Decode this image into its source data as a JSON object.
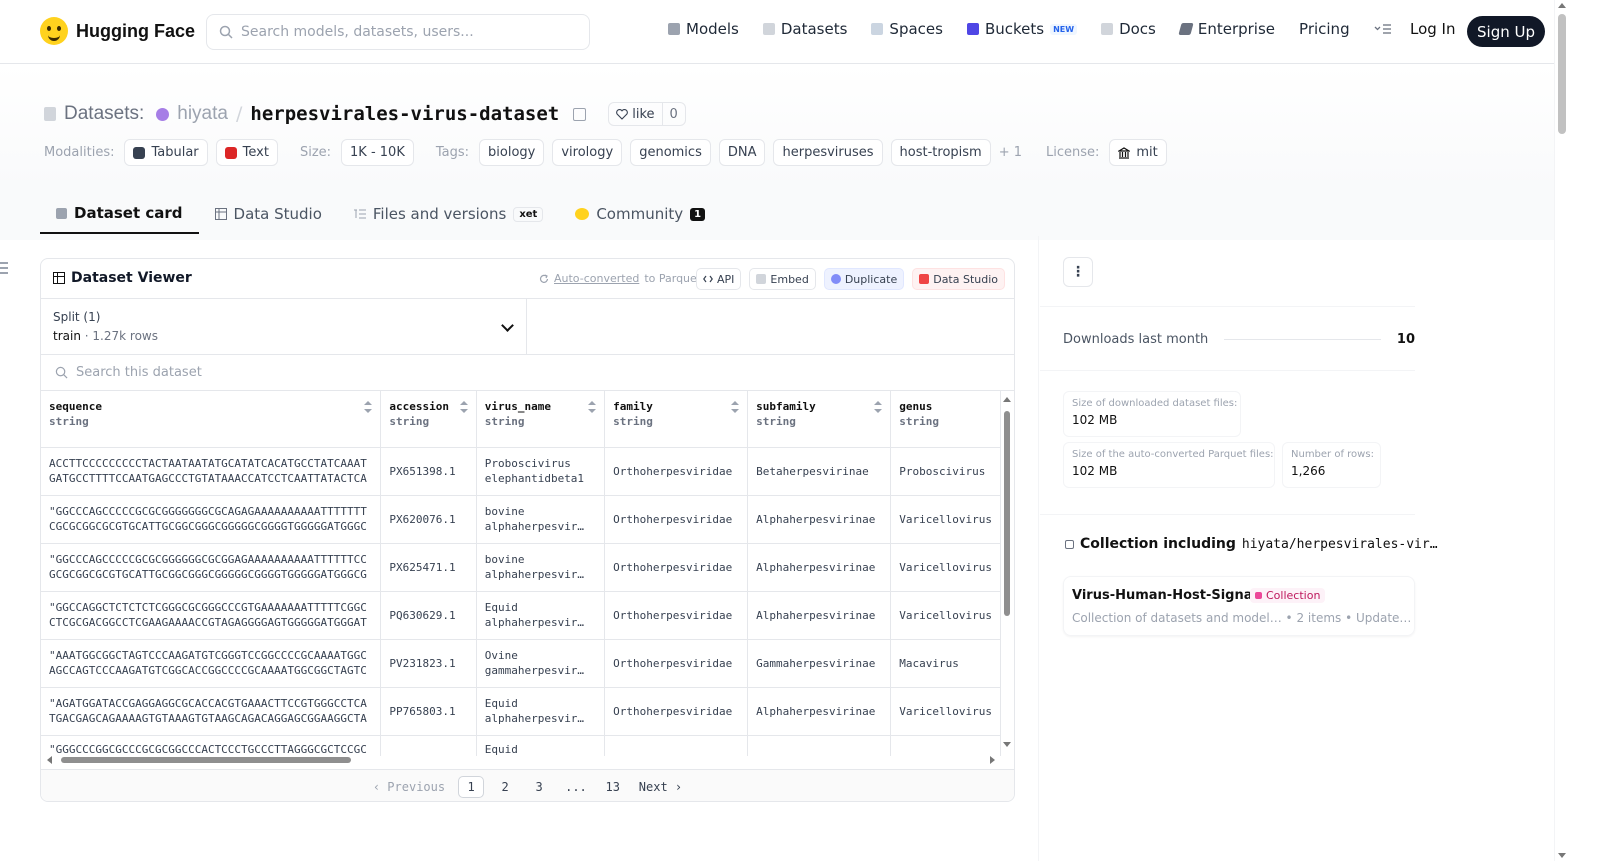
{
  "nav": {
    "brand": "Hugging Face",
    "search_placeholder": "Search models, datasets, users...",
    "links": [
      "Models",
      "Datasets",
      "Spaces",
      "Buckets",
      "Docs",
      "Enterprise",
      "Pricing"
    ],
    "buckets_badge": "NEW",
    "login": "Log In",
    "signup": "Sign Up"
  },
  "header": {
    "datasets_label": "Datasets:",
    "owner": "hiyata",
    "slash": "/",
    "repo": "herpesvirales-virus-dataset",
    "like_label": "like",
    "like_count": "0",
    "modalities_label": "Modalities:",
    "modalities": [
      "Tabular",
      "Text"
    ],
    "size_label": "Size:",
    "size": "1K - 10K",
    "tags_label": "Tags:",
    "tags": [
      "biology",
      "virology",
      "genomics",
      "DNA",
      "herpesviruses",
      "host-tropism"
    ],
    "tags_more": "+ 1",
    "license_label": "License:",
    "license": "mit"
  },
  "tabs": {
    "card": "Dataset card",
    "studio": "Data Studio",
    "files": "Files and versions",
    "xet": "xet",
    "community": "Community",
    "community_count": "1"
  },
  "viewer": {
    "title": "Dataset Viewer",
    "autoconv_link": "Auto-converted",
    "autoconv_rest": "to Parquet",
    "buttons": [
      "API",
      "Embed",
      "Duplicate",
      "Data Studio"
    ],
    "split_label": "Split (1)",
    "split_name": "train",
    "split_sep": "·",
    "split_rows": "1.27k rows",
    "search_placeholder": "Search this dataset",
    "columns": [
      {
        "name": "sequence",
        "type": "string"
      },
      {
        "name": "accession",
        "type": "string"
      },
      {
        "name": "virus_name",
        "type": "string"
      },
      {
        "name": "family",
        "type": "string"
      },
      {
        "name": "subfamily",
        "type": "string"
      },
      {
        "name": "genus",
        "type": "string"
      }
    ],
    "rows": [
      {
        "sequence": "ACCTTCCCCCCCCCTACTAATAATATGCATATCACATGCCTATCAAATGATGCCTTTTCCAATGAGCCCTGTATAAACCATCCTCAATTATACTCATTGGC…",
        "accession": "PX651398.1",
        "virus_name_1": "Proboscivirus",
        "virus_name_2": "elephantidbeta1",
        "family": "Orthoherpesviridae",
        "subfamily": "Betaherpesvirinae",
        "genus": "Proboscivirus"
      },
      {
        "sequence": "\"GGCCCAGCCCCCGCGCGGGGGGGCGCAGAGAAAAAAAAAATTTTTTTCGCGCGGCGCGTGCATTGCGGCGGGCGGGGGCGGGGTGGGGGATGGGCGCGG(…",
        "accession": "PX620076.1",
        "virus_name_1": "bovine",
        "virus_name_2": "alphaherpesvir…",
        "family": "Orthoherpesviridae",
        "subfamily": "Alphaherpesvirinae",
        "genus": "Varicellovirus"
      },
      {
        "sequence": "\"GGCCCAGCCCCCGCGCGGGGGGCGCGGAGAAAAAAAAAATTTTTTCCGCGCGGCGCGTGCATTGCGGCGGGCGGGGGCGGGGTGGGGGATGGGCGCGGA(…",
        "accession": "PX625471.1",
        "virus_name_1": "bovine",
        "virus_name_2": "alphaherpesvir…",
        "family": "Orthoherpesviridae",
        "subfamily": "Alphaherpesvirinae",
        "genus": "Varicellovirus"
      },
      {
        "sequence": "\"GGCCAGGCTCTCTCTCGGGCGCGGGCCCGTGAAAAAAATTTTTCGGCCTCGCGACGGCCTCGAAGAAAACCGTAGAGGGGAGTGGGGGATGGGATTTTT(…",
        "accession": "PQ630629.1",
        "virus_name_1": "Equid",
        "virus_name_2": "alphaherpesvir…",
        "family": "Orthoherpesviridae",
        "subfamily": "Alphaherpesvirinae",
        "genus": "Varicellovirus"
      },
      {
        "sequence": "\"AAATGGCGGCTAGTCCCAAGATGTCGGGTCCGGCCCCGCAAAATGGCAGCCAGTCCCAAGATGTCGGCACCGGCCCCGCAAAATGGCGGCTAGTCCCAA(…",
        "accession": "PV231823.1",
        "virus_name_1": "Ovine",
        "virus_name_2": "gammaherpesvir…",
        "family": "Orthoherpesviridae",
        "subfamily": "Gammaherpesvirinae",
        "genus": "Macavirus"
      },
      {
        "sequence": "\"AGATGGATACCGAGGAGGCGCACCACGTGAAACTTCCGTGGGCCTCATGACGAGCAGAAAAGTGTAAAGTGTAAGCAGACAGGAGCGGAAGGCTAAAT(…",
        "accession": "PP765803.1",
        "virus_name_1": "Equid",
        "virus_name_2": "alphaherpesvir…",
        "family": "Orthoherpesviridae",
        "subfamily": "Alphaherpesvirinae",
        "genus": "Varicellovirus"
      },
      {
        "sequence": "\"GGGCCCGGCGCCCGCGCGGCCCACTCCCTGCCCTTAGGGCGCTCCGCCC",
        "accession": "",
        "virus_name_1": "Equid",
        "virus_name_2": "",
        "family": "",
        "subfamily": "",
        "genus": ""
      }
    ],
    "pager": {
      "prev": "Previous",
      "pages": [
        "1",
        "2",
        "3",
        "...",
        "13"
      ],
      "next": "Next"
    }
  },
  "sidebar": {
    "kebab": "⋮",
    "downloads_label": "Downloads last month",
    "downloads_value": "10",
    "size_downloaded_label": "Size of downloaded dataset files:",
    "size_downloaded_value": "102 MB",
    "size_parquet_label": "Size of the auto-converted Parquet files:",
    "size_parquet_value": "102 MB",
    "num_rows_label": "Number of rows:",
    "num_rows_value": "1,266",
    "collection_heading": "Collection including",
    "collection_repo": "hiyata/herpesvirales-vir…",
    "collection_name": "Virus-Human-Host-Signals",
    "collection_badge": "Collection",
    "collection_meta": "Collection of datasets and model…  •  2 items  •  Update…"
  },
  "colors": {
    "brand_yellow": "#FFD21E",
    "dark": "#111827",
    "border": "#e5e7eb"
  }
}
